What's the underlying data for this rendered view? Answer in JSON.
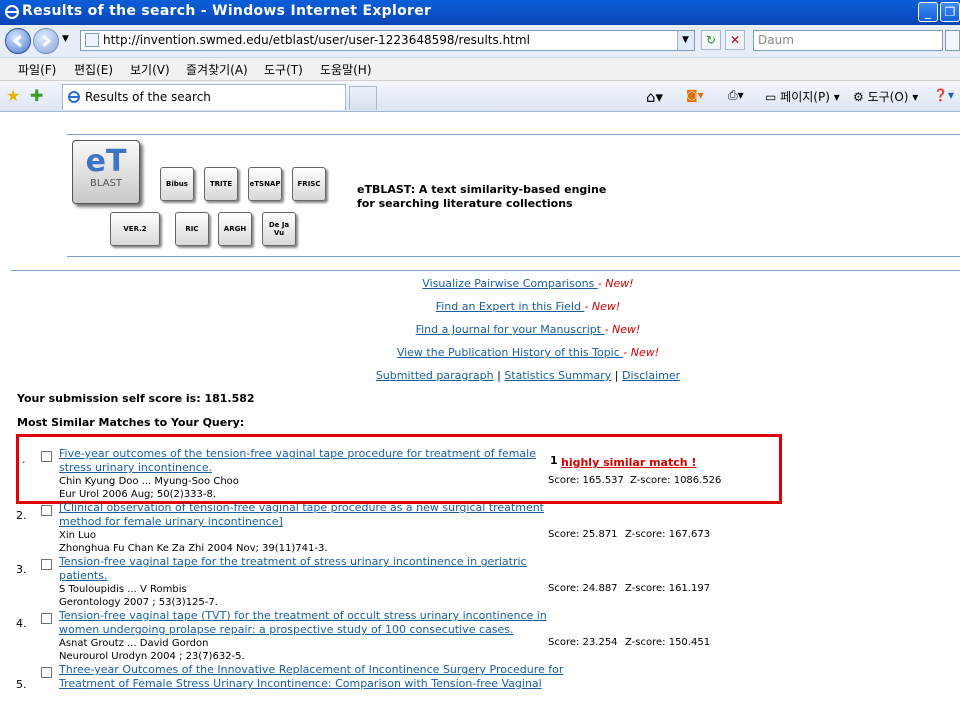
{
  "window": {
    "title": "Results of the search - Windows Internet Explorer"
  },
  "addressbar": {
    "url": "http://invention.swmed.edu/etblast/user/user-1223648598/results.html",
    "search_placeholder": "Daum"
  },
  "menu": [
    "파일(F)",
    "편집(E)",
    "보기(V)",
    "즐겨찾기(A)",
    "도구(T)",
    "도움말(H)"
  ],
  "tab": {
    "label": "Results of the search"
  },
  "commandbar": {
    "page": "페이지(P)",
    "tools": "도구(O)"
  },
  "site": {
    "logo_big": {
      "title": "eT",
      "sub": "BLAST"
    },
    "keys_row1": [
      "Bibus",
      "TRITE",
      "eTSNAP",
      "FRISC"
    ],
    "keys_row2": [
      "VER.2",
      "RIC",
      "ARGH",
      "De Ja Vu"
    ],
    "tagline": "eTBLAST: A text similarity-based engine for searching literature collections"
  },
  "links": [
    {
      "text": "Visualize Pairwise Comparisons ",
      "new": "- New!"
    },
    {
      "text": "Find an Expert in this Field ",
      "new": "- New!"
    },
    {
      "text": "Find a Journal for your Manuscript ",
      "new": "- New!"
    },
    {
      "text": "View the Publication History of this Topic ",
      "new": "- New!"
    }
  ],
  "sublinks": {
    "a": "Submitted paragraph",
    "b": "Statistics Summary",
    "c": "Disclaimer",
    "sep": "|"
  },
  "self_score": "Your submission self score is: 181.582",
  "matches_heading": "Most Similar Matches to Your Query:",
  "results": [
    {
      "num": ".",
      "title1": "Five-year outcomes of the tension-free vaginal tape procedure for treatment of female",
      "title2": "stress urinary incontinence.",
      "authors": "Chin Kyung Doo ... Myung-Soo Choo",
      "citation": "Eur Urol 2006 Aug; 50(2)333-8.",
      "score": "Score: 165.537",
      "zscore": "Z-score: 1086.526",
      "badge_num": "1",
      "badge": "highly similar match !"
    },
    {
      "num": "2.",
      "title1": "[Clinical observation of tension-free vaginal tape procedure as a new surgical treatment",
      "title2": "method for female urinary incontinence]",
      "authors": "Xin Luo",
      "citation": "Zhonghua Fu Chan Ke Za Zhi 2004 Nov; 39(11)741-3.",
      "score": "Score: 25.871",
      "zscore": "Z-score: 167.673"
    },
    {
      "num": "3.",
      "title1": "Tension-free vaginal tape for the treatment of stress urinary incontinence in geriatric",
      "title2": "patients.",
      "authors": "S Touloupidis ... V Rombis",
      "citation": "Gerontology 2007 ; 53(3)125-7.",
      "score": "Score: 24.887",
      "zscore": "Z-score: 161.197"
    },
    {
      "num": "4.",
      "title1": "Tension-free vaginal tape (TVT) for the treatment of occult stress urinary incontinence in",
      "title2": "women undergoing prolapse repair: a prospective study of 100 consecutive cases.",
      "authors": "Asnat Groutz ... David Gordon",
      "citation": "Neurourol Urodyn 2004 ; 23(7)632-5.",
      "score": "Score: 23.254",
      "zscore": "Z-score: 150.451"
    },
    {
      "num": "5.",
      "title1": "Three-year Outcomes of the Innovative Replacement of Incontinence Surgery Procedure for",
      "title2": "Treatment of Female Stress Urinary Incontinence: Comparison with Tension-free Vaginal"
    }
  ]
}
